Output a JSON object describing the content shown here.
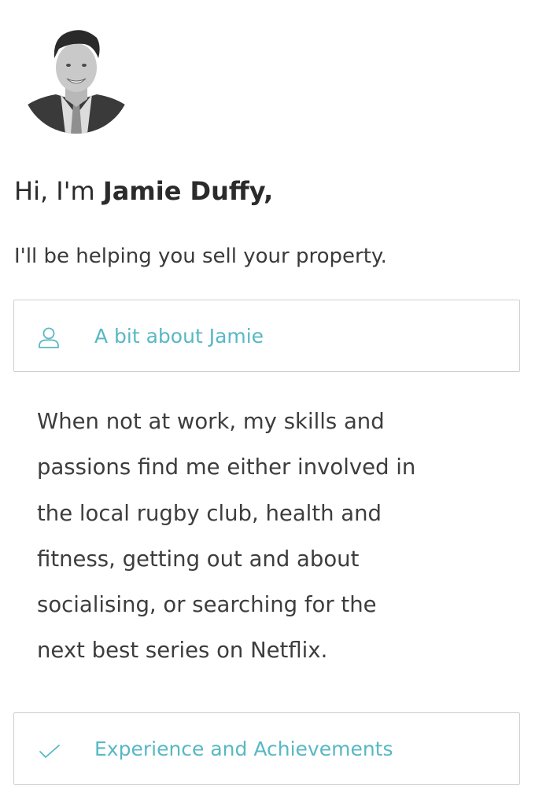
{
  "profile": {
    "avatar_alt": "Jamie Duffy",
    "greeting_prefix": "Hi, I'm ",
    "name": "Jamie Duffy,",
    "subtitle": "I'll be helping you sell your property."
  },
  "sections": {
    "about": {
      "label": "A bit about Jamie",
      "icon": "user-icon",
      "body_lines": [
        "When not at work, my skills and",
        "passions find me either involved in",
        "the local rugby club, health and",
        "fitness, getting out and about",
        "socialising, or searching for the",
        "next best series on Netflix."
      ]
    },
    "experience": {
      "label": "Experience and Achievements",
      "icon": "checkmark-icon"
    }
  },
  "colors": {
    "accent": "#58b8c4",
    "text": "#333333",
    "border": "#cfcfcf"
  }
}
